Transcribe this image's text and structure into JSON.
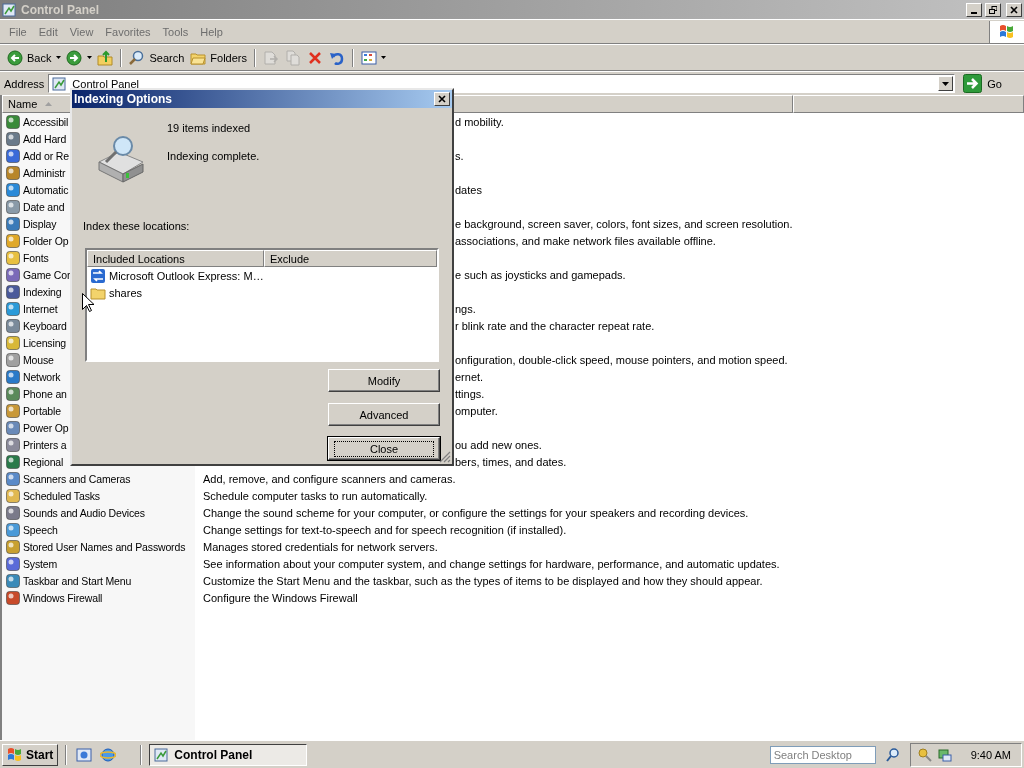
{
  "window": {
    "title": "Control Panel"
  },
  "menu": [
    "File",
    "Edit",
    "View",
    "Favorites",
    "Tools",
    "Help"
  ],
  "toolbar": [
    [
      {
        "kind": "back",
        "label": "Back",
        "disabled": false
      },
      {
        "kind": "forward",
        "disabled": false
      },
      {
        "kind": "up",
        "disabled": false
      }
    ],
    [
      {
        "kind": "search",
        "label": "Search",
        "disabled": false
      },
      {
        "kind": "folders",
        "label": "Folders",
        "disabled": false
      }
    ],
    [
      {
        "kind": "move",
        "disabled": true
      },
      {
        "kind": "copy",
        "disabled": true
      },
      {
        "kind": "delete",
        "disabled": false
      },
      {
        "kind": "undo",
        "disabled": false
      }
    ],
    [
      {
        "kind": "views",
        "disabled": false
      }
    ]
  ],
  "address": {
    "label": "Address",
    "value": "Control Panel",
    "go": "Go"
  },
  "list": {
    "columns": [
      {
        "label": "Name",
        "sorted": true
      }
    ],
    "items": [
      {
        "kind": "partly_hidden",
        "name": "Accessibil",
        "description": "d mobility."
      },
      {
        "kind": "partly_hidden",
        "name": "Add Hard"
      },
      {
        "kind": "partly_hidden",
        "name": "Add or Re",
        "description": "s."
      },
      {
        "kind": "partly_hidden",
        "name": "Administr"
      },
      {
        "kind": "partly_hidden",
        "name": "Automatic",
        "description": "dates"
      },
      {
        "kind": "partly_hidden",
        "name": "Date and"
      },
      {
        "kind": "partly_hidden",
        "name": "Display",
        "description": "e background, screen saver, colors, font sizes, and screen resolution."
      },
      {
        "kind": "partly_hidden",
        "name": "Folder Op",
        "description": "associations, and make network files available offline."
      },
      {
        "kind": "partly_hidden",
        "name": "Fonts"
      },
      {
        "kind": "partly_hidden",
        "name": "Game Cor",
        "description": "e such as joysticks and gamepads."
      },
      {
        "kind": "partly_hidden",
        "name": "Indexing"
      },
      {
        "kind": "partly_hidden",
        "name": "Internet",
        "description": "ngs."
      },
      {
        "kind": "partly_hidden",
        "name": "Keyboard",
        "description": "r blink rate and the character repeat rate."
      },
      {
        "kind": "partly_hidden",
        "name": "Licensing"
      },
      {
        "kind": "partly_hidden",
        "name": "Mouse",
        "description": "onfiguration, double-click speed, mouse pointers, and motion speed."
      },
      {
        "kind": "partly_hidden",
        "name": "Network",
        "description": "ernet."
      },
      {
        "kind": "partly_hidden",
        "name": "Phone an",
        "description": "ttings."
      },
      {
        "kind": "partly_hidden",
        "name": "Portable",
        "description": "omputer."
      },
      {
        "kind": "partly_hidden",
        "name": "Power Op"
      },
      {
        "kind": "partly_hidden",
        "name": "Printers a",
        "description": "ou add new ones."
      },
      {
        "kind": "partly_hidden",
        "name": "Regional",
        "description": "bers, times, and dates."
      },
      {
        "kind": "whole",
        "name": "Scanners and Cameras",
        "description": "Add, remove, and configure scanners and cameras."
      },
      {
        "kind": "whole",
        "name": "Scheduled Tasks",
        "description": "Schedule computer tasks to run automatically."
      },
      {
        "kind": "whole",
        "name": "Sounds and Audio Devices",
        "description": "Change the sound scheme for your computer, or configure the settings for your speakers and recording devices."
      },
      {
        "kind": "whole",
        "name": "Speech",
        "description": "Change settings for text-to-speech and for speech recognition (if installed)."
      },
      {
        "kind": "whole",
        "name": "Stored User Names and Passwords",
        "description": "Manages stored credentials for network servers."
      },
      {
        "kind": "whole",
        "name": "System",
        "description": "See information about your computer system, and change settings for hardware, performance, and automatic updates."
      },
      {
        "kind": "whole",
        "name": "Taskbar and Start Menu",
        "description": "Customize the Start Menu and the taskbar, such as the types of items to be displayed and how they should appear."
      },
      {
        "kind": "whole",
        "name": "Windows Firewall",
        "description": "Configure the Windows Firewall"
      }
    ]
  },
  "dialog": {
    "title": "Indexing Options",
    "count": "19 items indexed",
    "status": "Indexing complete.",
    "locations_label": "Index these locations:",
    "columns": [
      "Included Locations",
      "Exclude"
    ],
    "locations": [
      {
        "kind": "mail",
        "name": "Microsoft Outlook Express: M…"
      },
      {
        "kind": "folder",
        "name": "shares"
      }
    ],
    "buttons": [
      {
        "label": "Modify",
        "focused": false
      },
      {
        "label": "Advanced",
        "focused": false
      },
      {
        "label": "Close",
        "focused": true
      }
    ]
  },
  "taskbar": {
    "start": "Start",
    "tasks": [
      {
        "label": "Control Panel",
        "selected": true
      }
    ],
    "search": {
      "placeholder": "Search Desktop"
    },
    "clock": "9:40 AM"
  }
}
